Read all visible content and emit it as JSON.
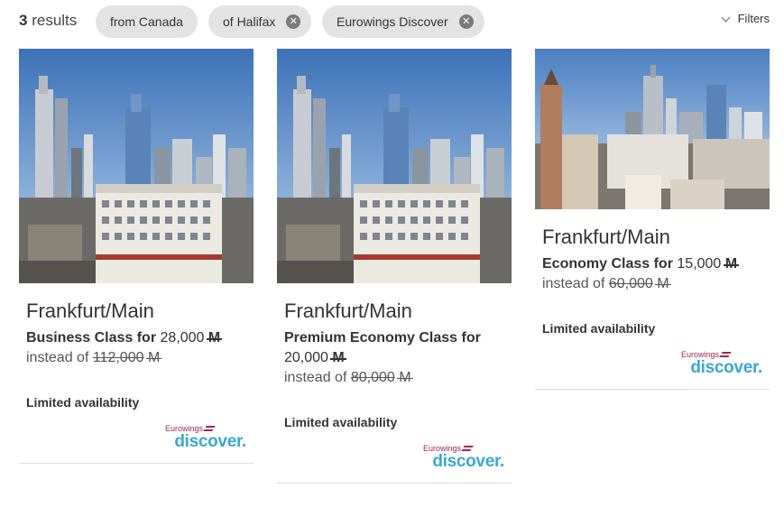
{
  "header": {
    "count": "3",
    "count_label": "results",
    "filters_label": "Filters"
  },
  "chips": [
    {
      "label": "from Canada",
      "removable": false
    },
    {
      "label": "of Halifax",
      "removable": true
    },
    {
      "label": "Eurowings Discover",
      "removable": true
    }
  ],
  "icons": {
    "remove": "close-circle-icon",
    "filters": "chevron-down-icon",
    "currency": "miles-icon"
  },
  "cards": [
    {
      "city": "Frankfurt/Main",
      "class_label": "Business Class for",
      "price": "28,000",
      "instead_label": "instead of",
      "old_price": "112,000",
      "availability": "Limited availability",
      "logo_small": "Eurowings",
      "logo_big": "discover."
    },
    {
      "city": "Frankfurt/Main",
      "class_label": "Premium Economy Class for",
      "price": "20,000",
      "instead_label": "instead of",
      "old_price": "80,000",
      "availability": "Limited availability",
      "logo_small": "Eurowings",
      "logo_big": "discover."
    },
    {
      "city": "Frankfurt/Main",
      "class_label": "Economy Class for",
      "price": "15,000",
      "instead_label": "instead of",
      "old_price": "60,000",
      "availability": "Limited availability",
      "logo_small": "Eurowings",
      "logo_big": "discover."
    }
  ],
  "colors": {
    "chip_bg": "#e3e3e3",
    "brand_magenta": "#a0245a",
    "brand_blue": "#3aa6d8"
  }
}
